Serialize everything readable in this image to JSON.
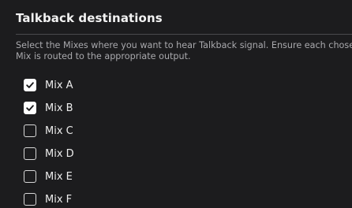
{
  "panel": {
    "title": "Talkback destinations",
    "description": "Select the Mixes where you want to hear Talkback signal. Ensure each chosen Mix is routed to the appropriate output.",
    "mixes": [
      {
        "label": "Mix A",
        "checked": true
      },
      {
        "label": "Mix B",
        "checked": true
      },
      {
        "label": "Mix C",
        "checked": false
      },
      {
        "label": "Mix D",
        "checked": false
      },
      {
        "label": "Mix E",
        "checked": false
      },
      {
        "label": "Mix F",
        "checked": false
      }
    ]
  },
  "colors": {
    "background": "#1c1c1e",
    "checked_fill": "#ffffff",
    "checkmark": "#1c1c1e",
    "description_text": "#a9a9ad"
  },
  "icons": {
    "checked": "checkmark-icon"
  }
}
